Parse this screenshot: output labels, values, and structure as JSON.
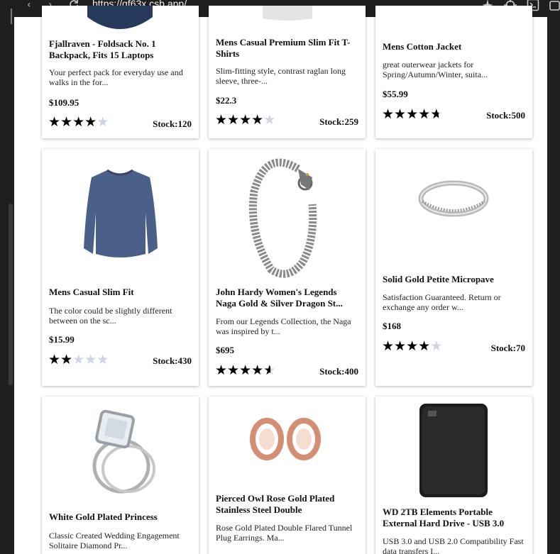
{
  "browser": {
    "url": "https://qf63x.csb.app/",
    "back_icon": "chevron-left-icon",
    "forward_icon": "chevron-right-icon",
    "reload_icon": "reload-icon"
  },
  "products": [
    {
      "title": "Fjallraven - Foldsack No. 1 Backpack, Fits 15 Laptops",
      "description": "Your perfect pack for everyday use and walks in the for...",
      "price": "$109.95",
      "rating": 4,
      "stock": "Stock:120"
    },
    {
      "title": "Mens Casual Premium Slim Fit T-Shirts",
      "description": "Slim-fitting style, contrast raglan long sleeve, three-...",
      "price": "$22.3",
      "rating": 4,
      "stock": "Stock:259"
    },
    {
      "title": "Mens Cotton Jacket",
      "description": "great outerwear jackets for Spring/Autumn/Winter, suita...",
      "price": "$55.99",
      "rating": 4.7,
      "stock": "Stock:500"
    },
    {
      "title": "Mens Casual Slim Fit",
      "description": "The color could be slightly different between on the sc...",
      "price": "$15.99",
      "rating": 2.1,
      "stock": "Stock:430"
    },
    {
      "title": "John Hardy Women's Legends Naga Gold & Silver Dragon St...",
      "description": "From our Legends Collection, the Naga was inspired by t...",
      "price": "$695",
      "rating": 4.6,
      "stock": "Stock:400"
    },
    {
      "title": "Solid Gold Petite Micropave",
      "description": "Satisfaction Guaranteed. Return or exchange any order w...",
      "price": "$168",
      "rating": 4,
      "stock": "Stock:70"
    },
    {
      "title": "White Gold Plated Princess",
      "description": "Classic Created Wedding Engagement Solitaire Diamond Pr...",
      "price": "",
      "rating": 0,
      "stock": ""
    },
    {
      "title": "Pierced Owl Rose Gold Plated Stainless Steel Double",
      "description": "Rose Gold Plated Double Flared Tunnel Plug Earrings. Ma...",
      "price": "",
      "rating": 0,
      "stock": ""
    },
    {
      "title": "WD 2TB Elements Portable External Hard Drive - USB 3.0",
      "description": "USB 3.0 and USB 2.0 Compatibility Fast data transfers I...",
      "price": "",
      "rating": 0,
      "stock": ""
    }
  ]
}
